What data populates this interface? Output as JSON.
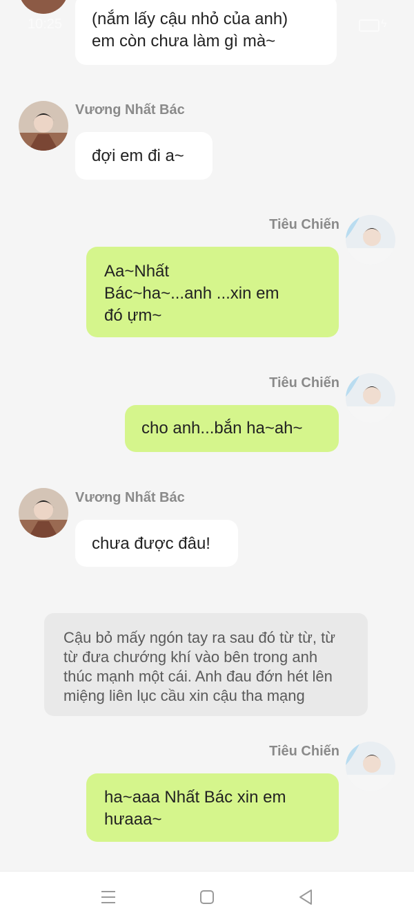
{
  "status_bar": {
    "time": "10:25"
  },
  "participants": {
    "left_name": "Vương Nhất Bác",
    "right_name": "Tiêu Chiến"
  },
  "messages": [
    {
      "side": "left",
      "text_lines": [
        "(nắm lấy cậu nhỏ của anh)",
        "em còn chưa làm gì mà~"
      ]
    },
    {
      "side": "left",
      "sender": "Vương Nhất Bác",
      "text_lines": [
        "đợi em đi a~"
      ]
    },
    {
      "side": "right",
      "sender": "Tiêu Chiến",
      "text_lines": [
        "Aa~Nhất",
        "Bác~ha~...anh ...xin em",
        "đó ựm~"
      ]
    },
    {
      "side": "right",
      "sender": "Tiêu Chiến",
      "text_lines": [
        "cho anh...bắn ha~ah~"
      ]
    },
    {
      "side": "left",
      "sender": "Vương Nhất Bác",
      "text_lines": [
        "chưa được đâu!"
      ]
    },
    {
      "side": "narration",
      "text_lines": [
        "Cậu bỏ mấy ngón tay ra sau đó từ từ, từ",
        "từ đưa chướng khí vào bên trong anh",
        "thúc mạnh một cái. Anh đau đớn hét lên",
        "miệng liên lục cầu xin cậu tha mạng"
      ]
    },
    {
      "side": "right",
      "sender": "Tiêu Chiến",
      "text_lines": [
        "ha~aaa Nhất Bác xin em",
        "hưaaa~"
      ]
    }
  ],
  "nav_bar": {
    "icons": [
      "menu-icon",
      "home-icon",
      "back-icon"
    ]
  },
  "colors": {
    "background": "#f5f5f5",
    "left_bubble": "#ffffff",
    "right_bubble": "#d5f58c",
    "narration_bubble": "#e9e9e9",
    "name_text": "#8a8a8a"
  }
}
